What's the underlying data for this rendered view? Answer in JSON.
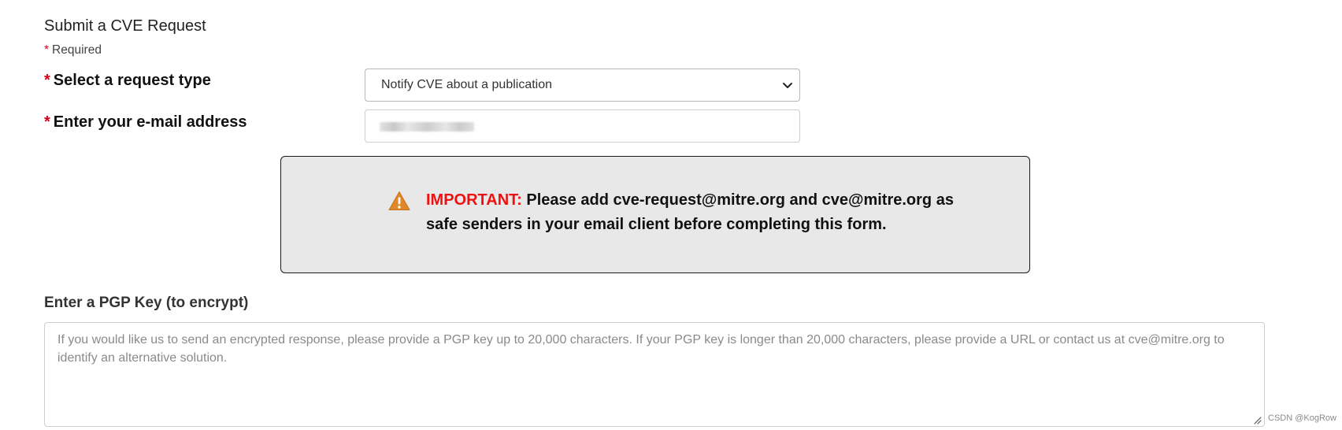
{
  "form": {
    "title": "Submit a CVE Request",
    "required_marker": "*",
    "required_note": "Required"
  },
  "request_type": {
    "label": "Select a request type",
    "selected_value": "Notify CVE about a publication"
  },
  "email": {
    "label": "Enter your e-mail address",
    "value": ""
  },
  "alert": {
    "icon": "warning-triangle-icon",
    "important_label": "IMPORTANT:",
    "message": "Please add cve-request@mitre.org and cve@mitre.org as safe senders in your email client before completing this form."
  },
  "pgp": {
    "label": "Enter a PGP Key (to encrypt)",
    "placeholder": "If you would like us to send an encrypted response, please provide a PGP key up to 20,000 characters. If your PGP key is longer than 20,000 characters, please provide a URL or contact us at cve@mitre.org to identify an alternative solution."
  },
  "watermark": "CSDN @KogRow",
  "colors": {
    "required_star": "#d6001c",
    "important_text": "#ee1111",
    "alert_background": "#e8e8e8",
    "warning_icon": "#e0872b"
  }
}
